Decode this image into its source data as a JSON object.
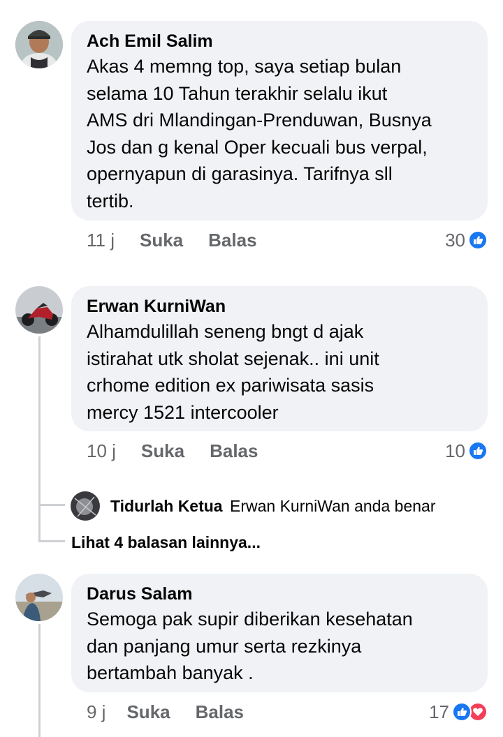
{
  "comments": [
    {
      "author": "Ach Emil Salim",
      "text": "Akas 4 memng top, saya setiap bulan\nselama 10 Tahun terakhir selalu ikut\nAMS dri Mlandingan-Prenduwan, Busnya\nJos dan g kenal Oper kecuali bus verpal,\nopernyapun di garasinya. Tarifnya sll\ntertib.",
      "time": "11 j",
      "like_label": "Suka",
      "reply_label": "Balas",
      "reaction_count": "30"
    },
    {
      "author": "Erwan KurniWan",
      "text": "Alhamdulillah seneng bngt d ajak\nistirahat utk sholat sejenak.. ini unit\ncrhome edition ex pariwisata sasis\nmercy 1521 intercooler",
      "time": "10 j",
      "like_label": "Suka",
      "reply_label": "Balas",
      "reaction_count": "10"
    },
    {
      "author": "Darus Salam",
      "text": "Semoga pak supir diberikan kesehatan\ndan panjang umur serta rezkinya\nbertambah banyak .",
      "time": "9 j",
      "like_label": "Suka",
      "reply_label": "Balas",
      "reaction_count": "17"
    }
  ],
  "reply": {
    "author": "Tidurlah Ketua",
    "text": "Erwan KurniWan anda benar"
  },
  "more_replies_label": "Lihat 4 balasan lainnya...",
  "colors": {
    "bubble": "#f0f2f5",
    "like_blue": "#1877f2",
    "love_red": "#f33e58",
    "secondary_text": "#65676b"
  },
  "icons": [
    "like-reaction-icon",
    "love-reaction-icon"
  ]
}
